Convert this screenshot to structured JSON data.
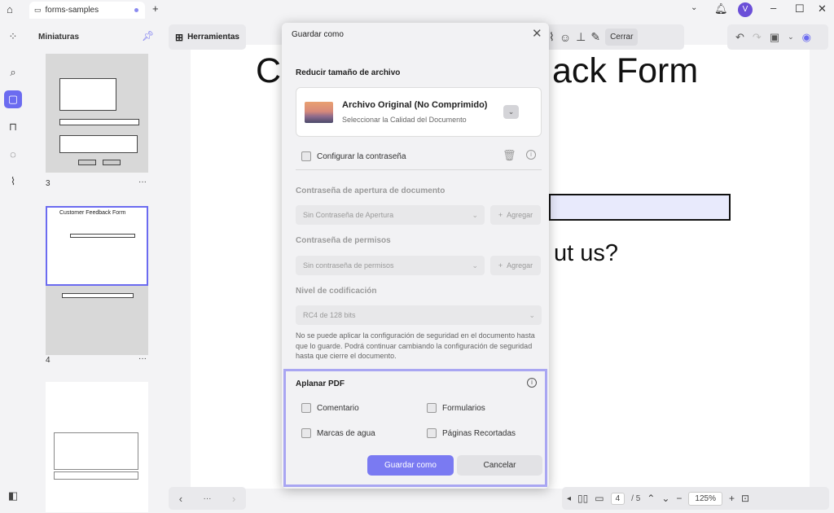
{
  "tab": {
    "title": "forms-samples"
  },
  "thumbnails": {
    "panel_title": "Miniaturas",
    "pages": [
      {
        "number": "3"
      },
      {
        "number": "4",
        "title": "Customer Feedback Form"
      },
      {
        "number": ""
      }
    ],
    "more": "···"
  },
  "toolbar": {
    "herramientas": "Herramientas",
    "cerrar": "Cerrar"
  },
  "document": {
    "heading_fragment": "ack Form",
    "heading_first_char": "C",
    "question_fragment": "ut us?"
  },
  "pagination": {
    "current": "4",
    "total": "/ 5",
    "zoom": "125%"
  },
  "modal": {
    "title": "Guardar como",
    "reduce_title": "Reducir tamaño de archivo",
    "quality_title": "Archivo Original (No Comprimido)",
    "quality_sub": "Seleccionar la Calidad del Documento",
    "set_password": "Configurar la contraseña",
    "open_pw_title": "Contraseña de apertura de documento",
    "open_pw_select": "Sin Contraseña de Apertura",
    "add": "Agregar",
    "perm_title": "Contraseña de permisos",
    "perm_select": "Sin contraseña de permisos",
    "enc_title": "Nivel de codificación",
    "enc_select": "RC4 de 128 bits",
    "note": "No se puede aplicar la configuración de seguridad en el documento hasta que lo guarde. Podrá continuar cambiando la configuración de seguridad hasta que cierre el documento.",
    "flatten_title": "Aplanar PDF",
    "opt_comment": "Comentario",
    "opt_forms": "Formularios",
    "opt_watermark": "Marcas de agua",
    "opt_cropped": "Páginas Recortadas",
    "save_button": "Guardar como",
    "cancel_button": "Cancelar"
  },
  "colors": {
    "accent": "#6b6bf0",
    "primary_button": "#7a7af2",
    "highlight_border": "#a9a6f2"
  }
}
